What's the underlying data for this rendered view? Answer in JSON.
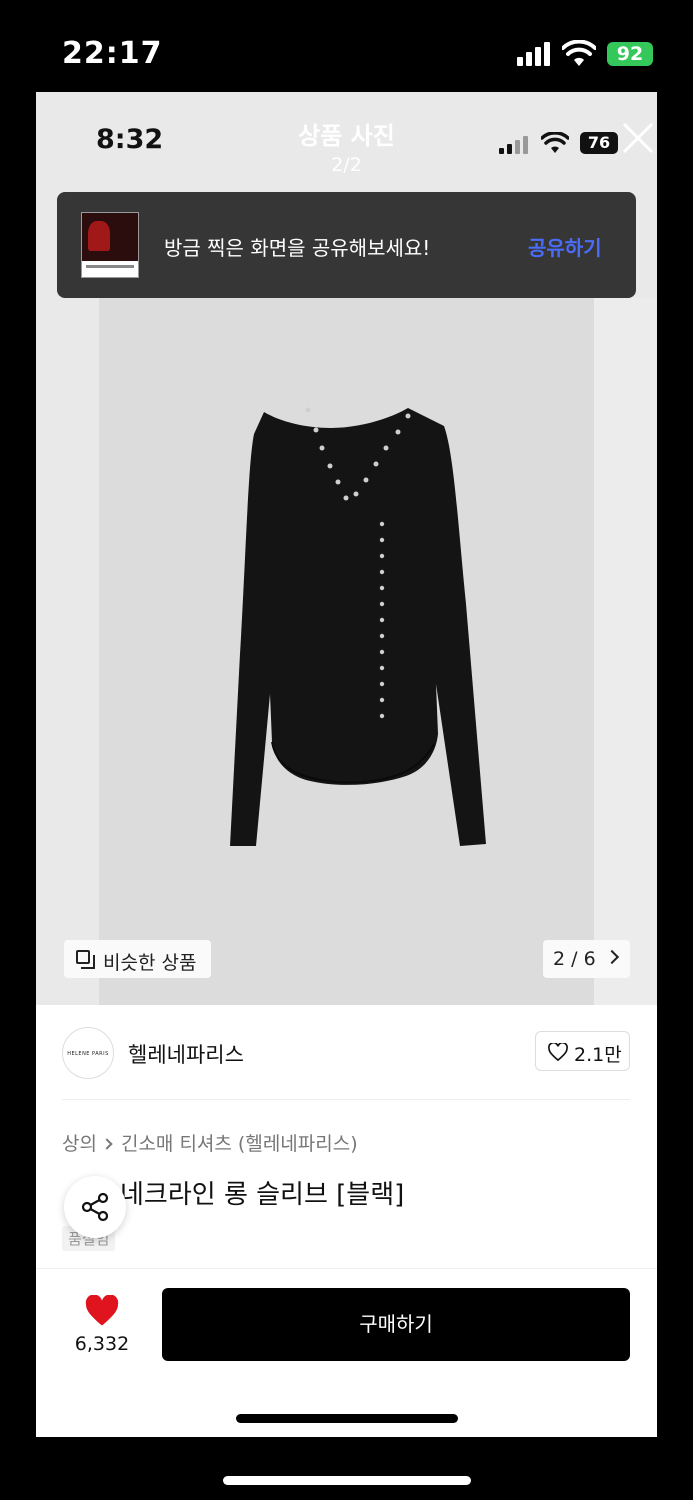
{
  "outer_status": {
    "time": "22:17",
    "battery": "92"
  },
  "inner_status": {
    "time": "8:32",
    "battery": "76"
  },
  "viewer": {
    "title": "상품 사진",
    "page": "2/2"
  },
  "share_toast": {
    "message": "방금 찍은 화면을 공유해보세요!",
    "action": "공유하기"
  },
  "photo": {
    "similar_label": "비슷한 상품",
    "counter": "2 / 6"
  },
  "brand": {
    "logo_text": "HELENE PARIS",
    "name": "헬레네파리스",
    "likes": "2.1만"
  },
  "breadcrumb": {
    "category": "상의",
    "subcategory": "긴소매 티셔츠 (헬레네파리스)"
  },
  "product": {
    "title": "네크라인 롱 슬리브 [블랙]",
    "sub_badge": "품절임"
  },
  "bottom": {
    "wish_count": "6,332",
    "buy_label": "구매하기"
  },
  "colors": {
    "accent_blue": "#4a6cf7",
    "heart_red": "#e0141e",
    "battery_green": "#34c759"
  }
}
